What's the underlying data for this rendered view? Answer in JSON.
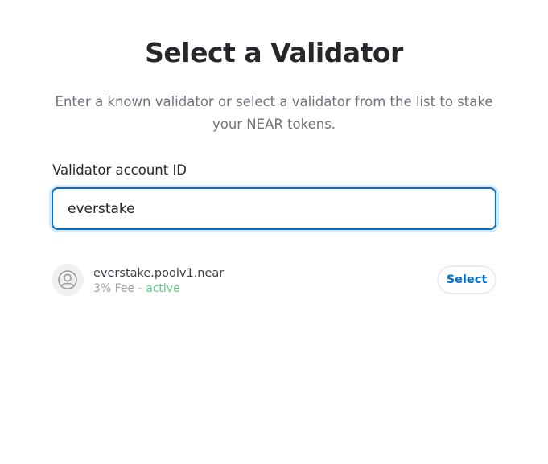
{
  "page": {
    "title": "Select a Validator",
    "subtitle": "Enter a known validator or select a validator from the list to stake your NEAR tokens."
  },
  "form": {
    "label": "Validator account ID",
    "input_value": "everstake"
  },
  "validators": [
    {
      "name": "everstake.poolv1.near",
      "fee": "3% Fee - ",
      "status": "active",
      "status_color": "#5ace84",
      "icon": "validator-avatar-icon",
      "select_label": "Select"
    }
  ],
  "colors": {
    "accent": "#0072ce",
    "title": "#25272a",
    "muted": "#72727a"
  }
}
